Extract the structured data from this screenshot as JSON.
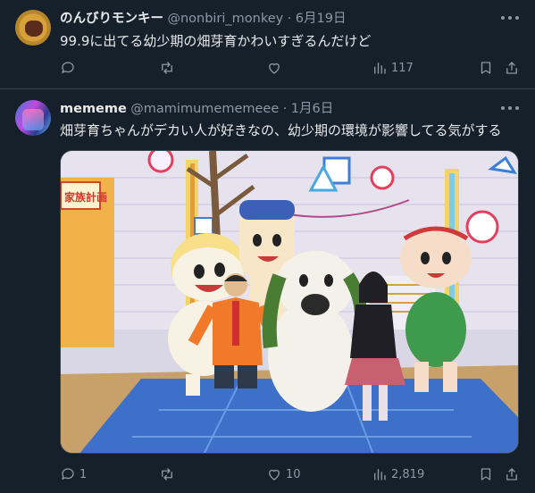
{
  "tweets": [
    {
      "display_name": "のんびりモンキー",
      "handle": "@nonbiri_monkey",
      "date": "6月19日",
      "text": "99.9に出てる幼少期の畑芽育かわいすぎるんだけど",
      "stats": {
        "replies": "",
        "retweets": "",
        "likes": "",
        "views": "117"
      },
      "icons": [
        "reply-icon",
        "retweet-icon",
        "like-icon",
        "views-icon",
        "bookmark-icon",
        "share-icon"
      ]
    },
    {
      "display_name": "mememe",
      "handle": "@mamimumememeee",
      "date": "1月6日",
      "text": "畑芽育ちゃんがデカい人が好きなの、幼少期の環境が影響してる気がする",
      "stats": {
        "replies": "1",
        "retweets": "",
        "likes": "10",
        "views": "2,819"
      },
      "icons": [
        "reply-icon",
        "retweet-icon",
        "like-icon",
        "views-icon",
        "bookmark-icon",
        "share-icon"
      ],
      "media_sign_text": "家族計画"
    }
  ],
  "separator": "·",
  "colors": {
    "background": "#15202b",
    "text": "#e7e9ea",
    "muted": "#8b98a5",
    "border": "#38444d"
  }
}
